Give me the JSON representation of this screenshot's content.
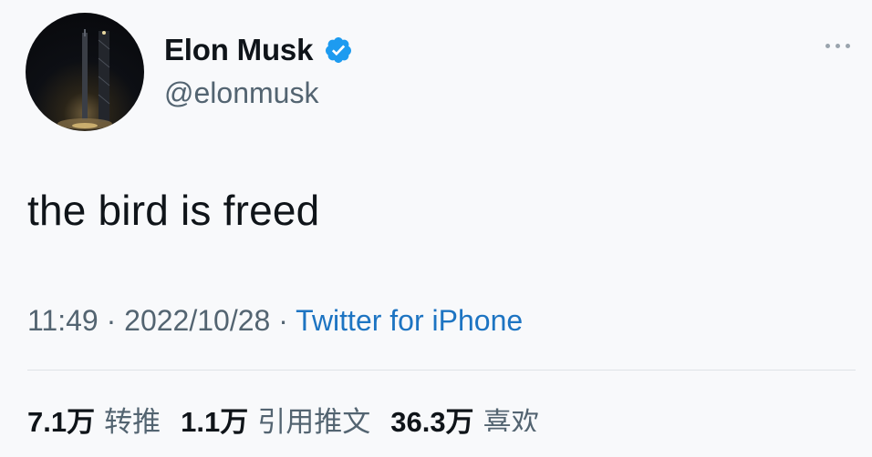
{
  "tweet": {
    "author": {
      "name": "Elon Musk",
      "handle": "@elonmusk",
      "verified": true,
      "avatar_icon": "rocket-launch-avatar"
    },
    "more_icon": "more-dots-icon",
    "text": "the bird is freed",
    "meta": {
      "time": "11:49",
      "separator": " · ",
      "date": "2022/10/28",
      "source": "Twitter for iPhone"
    },
    "stats": [
      {
        "count": "7.1万",
        "label": "转推"
      },
      {
        "count": "1.1万",
        "label": "引用推文"
      },
      {
        "count": "36.3万",
        "label": "喜欢"
      }
    ],
    "colors": {
      "verified": "#1d9bf0",
      "link": "#1d74c2",
      "secondary_text": "#536471"
    }
  }
}
